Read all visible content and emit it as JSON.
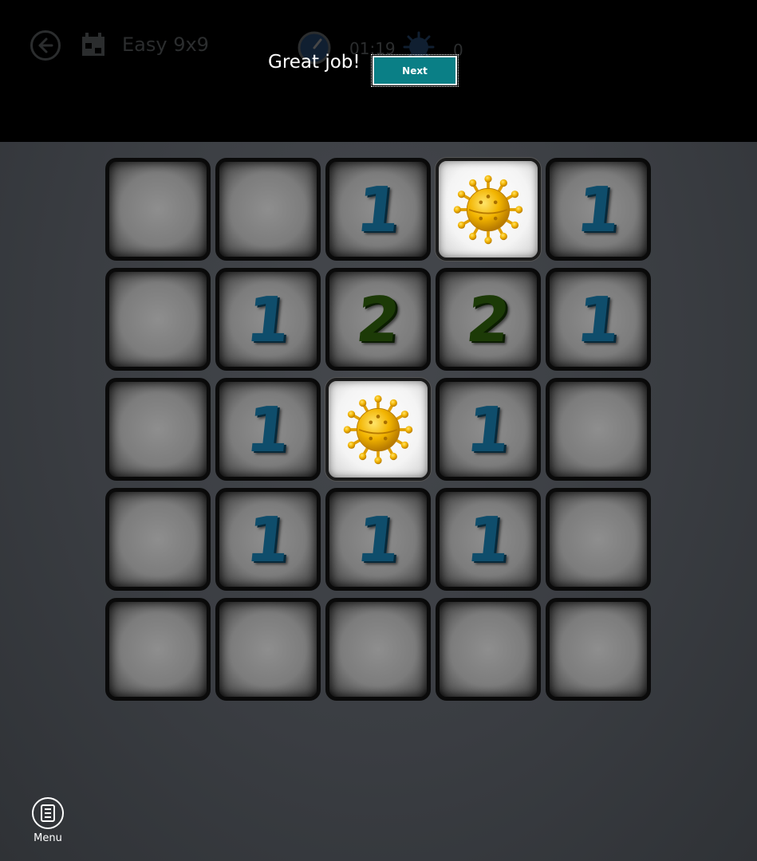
{
  "header": {
    "level_title": "Easy 9x9",
    "timer": "01:19",
    "mine_count": "0"
  },
  "overlay": {
    "message": "Great job!",
    "next_label": "Next"
  },
  "board": {
    "rows": 5,
    "cols": 5,
    "cells": [
      [
        "",
        "",
        "1",
        "mine",
        "1"
      ],
      [
        "",
        "1",
        "2",
        "2",
        "1"
      ],
      [
        "",
        "1",
        "mine",
        "1",
        ""
      ],
      [
        "",
        "1",
        "1",
        "1",
        ""
      ],
      [
        "",
        "",
        "",
        "",
        ""
      ]
    ]
  },
  "colors": {
    "number_1": "#0f4d6b",
    "number_2": "#1c3a07",
    "next_button": "#0a7f86",
    "mine": "#f2b400"
  },
  "bottom": {
    "menu_label": "Menu"
  }
}
